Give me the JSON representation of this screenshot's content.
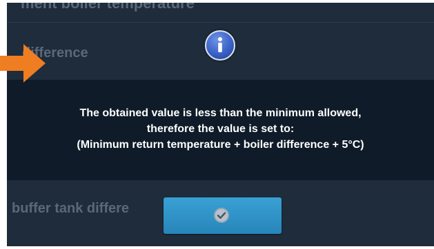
{
  "background": {
    "row1_label": "ment boiler temperature",
    "row2_label": "difference",
    "row3_label": "buffer tank differe"
  },
  "dialog": {
    "icon": "info-icon",
    "message_lines": [
      "The obtained value is less than the minimum allowed,",
      "therefore the value is set to:",
      "(Minimum return temperature + boiler difference + 5°C)"
    ],
    "confirm_icon": "check-icon"
  },
  "annotation": {
    "arrow_color": "#ef7d21"
  },
  "colors": {
    "screen_bg": "#1e2c3c",
    "panel_bg": "#0f1b28",
    "button_accent": "#2f93c8"
  }
}
